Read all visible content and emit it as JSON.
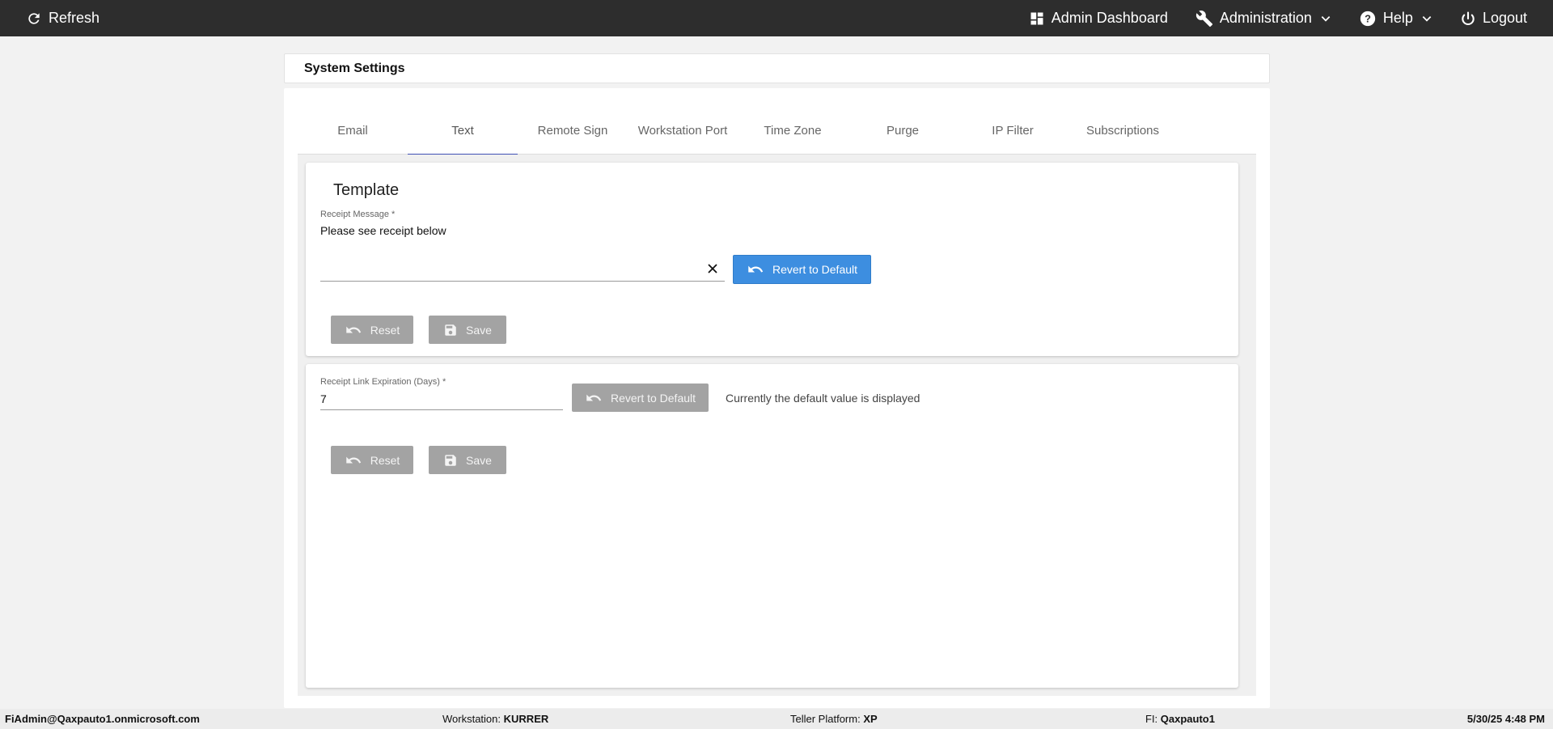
{
  "topbar": {
    "refresh_label": "Refresh",
    "admin_dashboard_label": "Admin Dashboard",
    "administration_label": "Administration",
    "help_label": "Help",
    "logout_label": "Logout"
  },
  "page": {
    "title": "System Settings"
  },
  "tabs": [
    {
      "label": "Email"
    },
    {
      "label": "Text"
    },
    {
      "label": "Remote Sign"
    },
    {
      "label": "Workstation Port"
    },
    {
      "label": "Time Zone"
    },
    {
      "label": "Purge"
    },
    {
      "label": "IP Filter"
    },
    {
      "label": "Subscriptions"
    }
  ],
  "active_tab": "Text",
  "template_panel": {
    "title": "Template",
    "receipt_message_label": "Receipt Message *",
    "receipt_message_value": "Please see receipt below",
    "revert_label": "Revert to Default",
    "reset_label": "Reset",
    "save_label": "Save"
  },
  "expiration_panel": {
    "label": "Receipt Link Expiration (Days) *",
    "value": "7",
    "revert_label": "Revert to Default",
    "note": "Currently the default value is displayed",
    "reset_label": "Reset",
    "save_label": "Save"
  },
  "footer": {
    "user": "FiAdmin@Qaxpauto1.onmicrosoft.com",
    "workstation_label": "Workstation:",
    "workstation_value": "KURRER",
    "platform_label": "Teller Platform:",
    "platform_value": "XP",
    "fi_label": "FI:",
    "fi_value": "Qaxpauto1",
    "datetime": "5/30/25 4:48 PM"
  },
  "colors": {
    "topbar": "#2d2d2d",
    "primary_button": "#3d8ee0",
    "disabled_button": "#a3a3a3",
    "active_tab_indicator": "#3f51b5"
  }
}
